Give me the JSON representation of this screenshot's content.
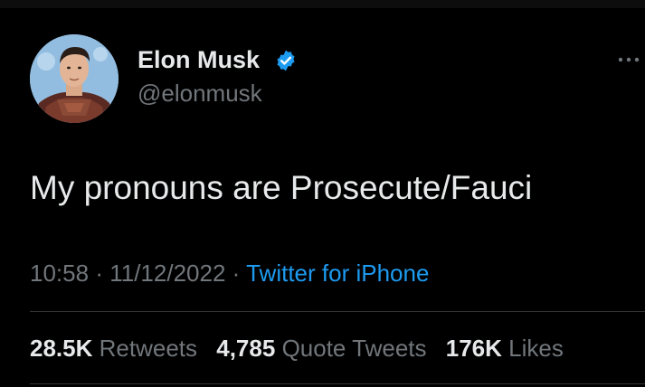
{
  "author": {
    "display_name": "Elon Musk",
    "handle": "@elonmusk",
    "verified": true,
    "avatar_icon": "profile-photo",
    "verified_icon": "verified-badge-icon"
  },
  "tweet": {
    "text": "My pronouns are Prosecute/Fauci"
  },
  "meta": {
    "time": "10:58",
    "separator": "·",
    "date": "11/12/2022",
    "source": "Twitter for iPhone"
  },
  "stats": {
    "retweets_count": "28.5K",
    "retweets_label": "Retweets",
    "quote_tweets_count": "4,785",
    "quote_tweets_label": "Quote Tweets",
    "likes_count": "176K",
    "likes_label": "Likes"
  },
  "colors": {
    "background": "#000000",
    "primary_text": "#e7e9ea",
    "secondary_text": "#71767b",
    "link": "#1d9bf0",
    "verified": "#1d9bf0",
    "divider": "#2f3336"
  }
}
